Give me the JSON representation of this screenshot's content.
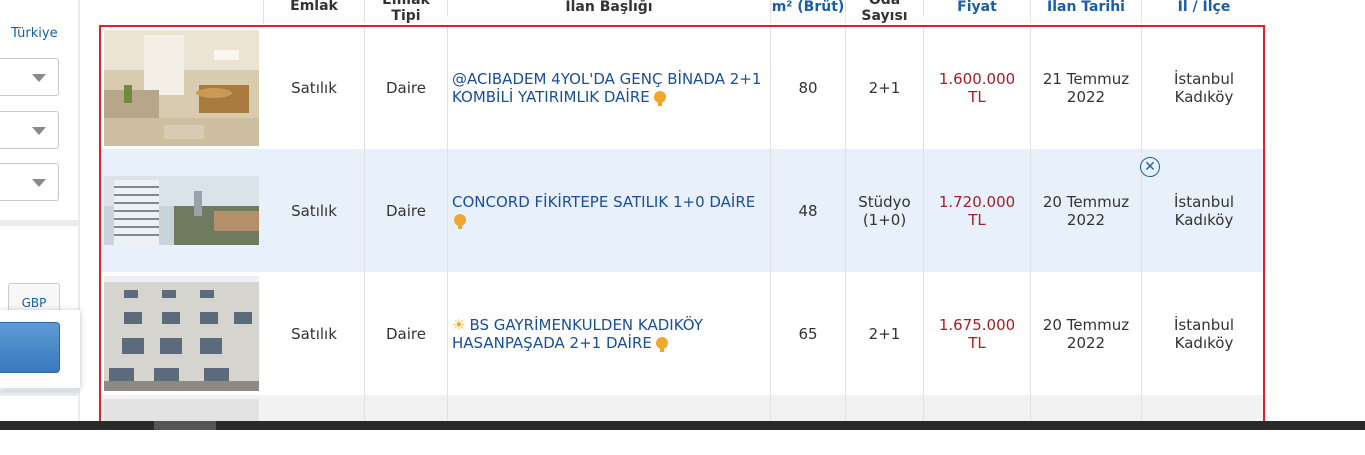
{
  "sidebar": {
    "country_link": "Türkiye",
    "currency_button": "GBP"
  },
  "headers": {
    "emlak": "Emlak",
    "emlak_tipi_1": "Emlak",
    "emlak_tipi_2": "Tipi",
    "ilan_basligi": "İlan Başlığı",
    "m2": "m² (Brüt)",
    "oda_1": "Oda",
    "oda_2": "Sayısı",
    "fiyat": "Fiyat",
    "ilan_tarihi": "İlan Tarihi",
    "il_ilce": "İl / İlçe"
  },
  "listings": [
    {
      "emlak": "Satılık",
      "tip": "Daire",
      "title_1": "@ACIBADEM 4YOL'DA GENÇ BİNADA 2+1",
      "title_2": "KOMBİLİ YATIRIMLIK DAİRE",
      "m2": "80",
      "oda_1": "2+1",
      "oda_2": "",
      "fiyat": "1.600.000 TL",
      "tarih_1": "21 Temmuz",
      "tarih_2": "2022",
      "il": "İstanbul",
      "ilce": "Kadıköy"
    },
    {
      "emlak": "Satılık",
      "tip": "Daire",
      "title_1": "CONCORD FİKİRTEPE SATILIK 1+0 DAİRE",
      "title_2": "",
      "m2": "48",
      "oda_1": "Stüdyo",
      "oda_2": "(1+0)",
      "fiyat": "1.720.000 TL",
      "tarih_1": "20 Temmuz",
      "tarih_2": "2022",
      "il": "İstanbul",
      "ilce": "Kadıköy"
    },
    {
      "emlak": "Satılık",
      "tip": "Daire",
      "title_1": "BS GAYRİMENKULDEN KADIKÖY",
      "title_2": "HASANPAŞADA 2+1 DAİRE",
      "m2": "65",
      "oda_1": "2+1",
      "oda_2": "",
      "fiyat": "1.675.000 TL",
      "tarih_1": "20 Temmuz",
      "tarih_2": "2022",
      "il": "İstanbul",
      "ilce": "Kadıköy"
    }
  ],
  "colors": {
    "link_blue": "#1a4e9b",
    "price_red": "#a41e23",
    "highlight_row": "#e8f1fb",
    "selection_frame": "#e0202a"
  }
}
